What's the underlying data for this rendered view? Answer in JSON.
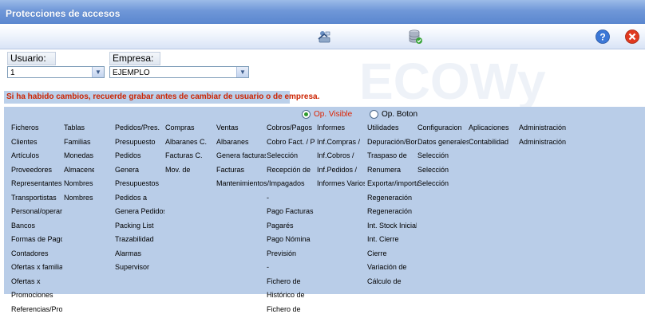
{
  "window": {
    "title": "Protecciones de accesos"
  },
  "toolbar": {
    "icons": [
      "user-access-icon",
      "database-check-icon",
      "help-icon",
      "close-icon"
    ]
  },
  "form": {
    "usuario_label": "Usuario:",
    "usuario_value": "1",
    "empresa_label": "Empresa:",
    "empresa_value": "EJEMPLO",
    "warning": "Si ha habido cambios, recuerde grabar antes de cambiar de usuario o de empresa."
  },
  "options": {
    "visible_label": "Op. Visible",
    "boton_label": "Op. Boton",
    "selected": "visible"
  },
  "colors": {
    "title_bar": "#6f97d8",
    "content_bg": "#b9cde8",
    "warning_text": "#cc2200",
    "selected_option": "#dd2200"
  },
  "menu": {
    "col1": [
      "Ficheros",
      "Clientes",
      "Artículos",
      "Proveedores",
      "Representantes",
      "Transportistas",
      "Personal/operarios",
      "Bancos",
      "Formas de Pago",
      "Contadores",
      "Ofertas x familia",
      "Ofertas x",
      "Promociones",
      "Referencias/Prov."
    ],
    "col2": [
      "Tablas",
      "Familias",
      "Monedas",
      "Almacenes",
      "Nombres",
      "Nombres"
    ],
    "col3": [
      "Pedidos/Pres.",
      "Presupuesto",
      "Pedidos",
      "Genera",
      "Presupuestos",
      "Pedidos a",
      "Genera Pedidos",
      "Packing List",
      "Trazabilidad",
      "Alarmas",
      "Supervisor"
    ],
    "col4": [
      "Compras",
      "Albaranes C.",
      "Facturas C.",
      "Mov. de"
    ],
    "col5": [
      "Ventas",
      "Albaranes",
      "Genera facturas",
      "Facturas",
      "Mantenimientos/Impagados"
    ],
    "col6": [
      "Cobros/Pagos",
      "Cobro Fact. / Pago",
      "Selección",
      "Recepción de",
      "",
      "-",
      "Pago Facturas",
      "Pagarés",
      "Pago Nómina",
      "Previsión",
      "-",
      "Fichero de",
      "Histórico de",
      "Fichero de"
    ],
    "col7": [
      "Informes",
      "Inf.Compras /",
      "Inf.Cobros /",
      "Inf.Pedidos /",
      "Informes Varios"
    ],
    "col8": [
      "Utilidades",
      "Depuración/Borrado",
      "Traspaso de",
      "Renumera",
      "Exportar/importar",
      "Regeneración",
      "Regeneración",
      "Int. Stock Inicial",
      "Int. Cierre",
      "Cierre",
      "Variación de",
      "Cálculo de"
    ],
    "col9": [
      "Configuracion",
      "Datos generales",
      "Selección",
      "Selección",
      "Selección"
    ],
    "col10": [
      "Aplicaciones",
      "Contabilidad"
    ],
    "col11": [
      "Administración",
      "Administración"
    ]
  }
}
